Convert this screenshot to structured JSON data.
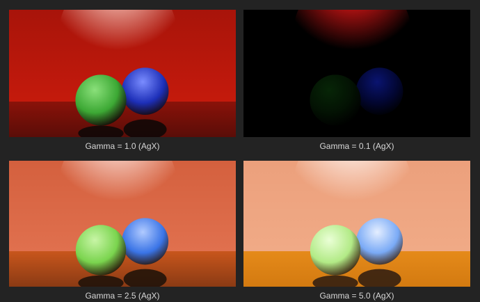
{
  "panels": [
    {
      "caption": "Gamma = 1.0 (AgX)",
      "colors": {
        "wall": "#c41a0c",
        "wall_dark": "#a8140a",
        "floor": "#5a0d08",
        "floor_far": "#8a1209",
        "light": "#ffd2c6",
        "green_ball": "#3ca834",
        "green_hi": "#8ae07a",
        "blue_ball": "#1d2fb8",
        "blue_hi": "#7a8cff",
        "reflection": "#0b0706"
      }
    },
    {
      "caption": "Gamma = 0.1 (AgX)",
      "colors": {
        "wall": "#000000",
        "wall_dark": "#000000",
        "floor": "#000000",
        "floor_far": "#000000",
        "light": "#ff1a1a",
        "green_ball": "#031203",
        "green_hi": "#072507",
        "blue_ball": "#020630",
        "blue_hi": "#0a1470",
        "reflection": "#000000"
      }
    },
    {
      "caption": "Gamma = 2.5 (AgX)",
      "colors": {
        "wall": "#e0704e",
        "wall_dark": "#d4603e",
        "floor": "#8a3a14",
        "floor_far": "#c8561c",
        "light": "#ffeae4",
        "green_ball": "#7ad44e",
        "green_hi": "#c8f5a6",
        "blue_ball": "#3a74e6",
        "blue_hi": "#b0caff",
        "reflection": "#1a1008"
      }
    },
    {
      "caption": "Gamma = 5.0 (AgX)",
      "colors": {
        "wall": "#f0aa86",
        "wall_dark": "#eca07c",
        "floor": "#d37a10",
        "floor_far": "#e58a1a",
        "light": "#fff6f2",
        "green_ball": "#b2ea86",
        "green_hi": "#eaffd6",
        "blue_ball": "#7aaaf6",
        "blue_hi": "#e4eeff",
        "reflection": "#2a1a10"
      }
    }
  ]
}
